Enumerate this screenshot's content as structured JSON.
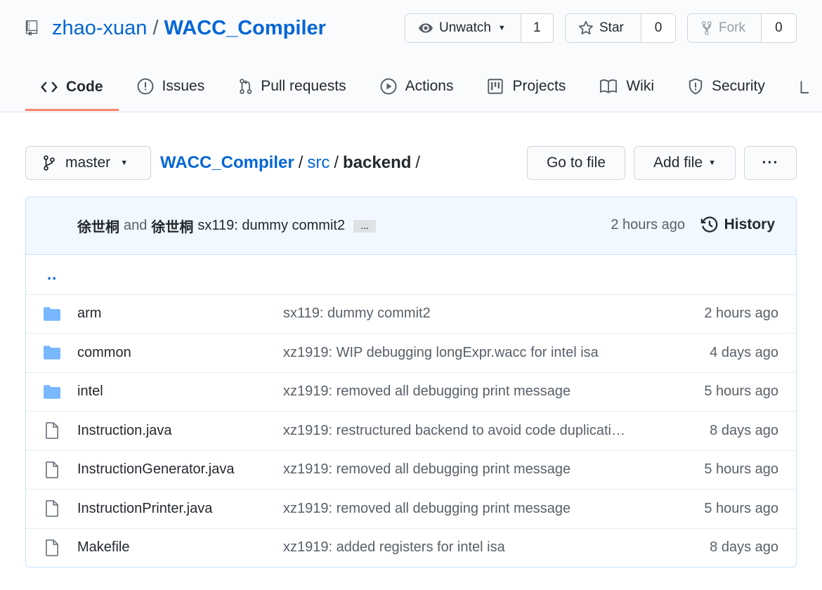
{
  "repo": {
    "owner": "zhao-xuan",
    "separator": "/",
    "name": "WACC_Compiler"
  },
  "actions": {
    "watch": {
      "label": "Unwatch",
      "count": "1"
    },
    "star": {
      "label": "Star",
      "count": "0"
    },
    "fork": {
      "label": "Fork",
      "count": "0"
    }
  },
  "tabs": [
    {
      "label": "Code",
      "icon": "code-icon",
      "selected": true
    },
    {
      "label": "Issues",
      "icon": "issue-opened-icon"
    },
    {
      "label": "Pull requests",
      "icon": "git-pull-request-icon"
    },
    {
      "label": "Actions",
      "icon": "play-icon"
    },
    {
      "label": "Projects",
      "icon": "project-icon"
    },
    {
      "label": "Wiki",
      "icon": "book-icon"
    },
    {
      "label": "Security",
      "icon": "shield-icon"
    }
  ],
  "branch": {
    "name": "master"
  },
  "breadcrumb": {
    "root": "WACC_Compiler",
    "sep": "/",
    "parts": [
      "src"
    ],
    "current": "backend",
    "trailing": "/"
  },
  "buttons": {
    "go_to_file": "Go to file",
    "add_file": "Add file",
    "more": "···"
  },
  "latest_commit": {
    "author1": "徐世桐",
    "and": "and",
    "author2": "徐世桐",
    "message": "sx119: dummy commit2",
    "ellipsis": "…",
    "time": "2 hours ago",
    "history_label": "History"
  },
  "updir": "..",
  "files": [
    {
      "type": "dir",
      "name": "arm",
      "message": "sx119: dummy commit2",
      "time": "2 hours ago"
    },
    {
      "type": "dir",
      "name": "common",
      "message": "xz1919: WIP debugging longExpr.wacc for intel isa",
      "time": "4 days ago"
    },
    {
      "type": "dir",
      "name": "intel",
      "message": "xz1919: removed all debugging print message",
      "time": "5 hours ago"
    },
    {
      "type": "file",
      "name": "Instruction.java",
      "message": "xz1919: restructured backend to avoid code duplicati…",
      "time": "8 days ago"
    },
    {
      "type": "file",
      "name": "InstructionGenerator.java",
      "message": "xz1919: removed all debugging print message",
      "time": "5 hours ago"
    },
    {
      "type": "file",
      "name": "InstructionPrinter.java",
      "message": "xz1919: removed all debugging print message",
      "time": "5 hours ago"
    },
    {
      "type": "file",
      "name": "Makefile",
      "message": "xz1919: added registers for intel isa",
      "time": "8 days ago"
    }
  ],
  "colors": {
    "link": "#0366d6",
    "tab_underline": "#f9826c",
    "folder": "#79b8ff",
    "commit_bar_bg": "#f1f8ff"
  }
}
